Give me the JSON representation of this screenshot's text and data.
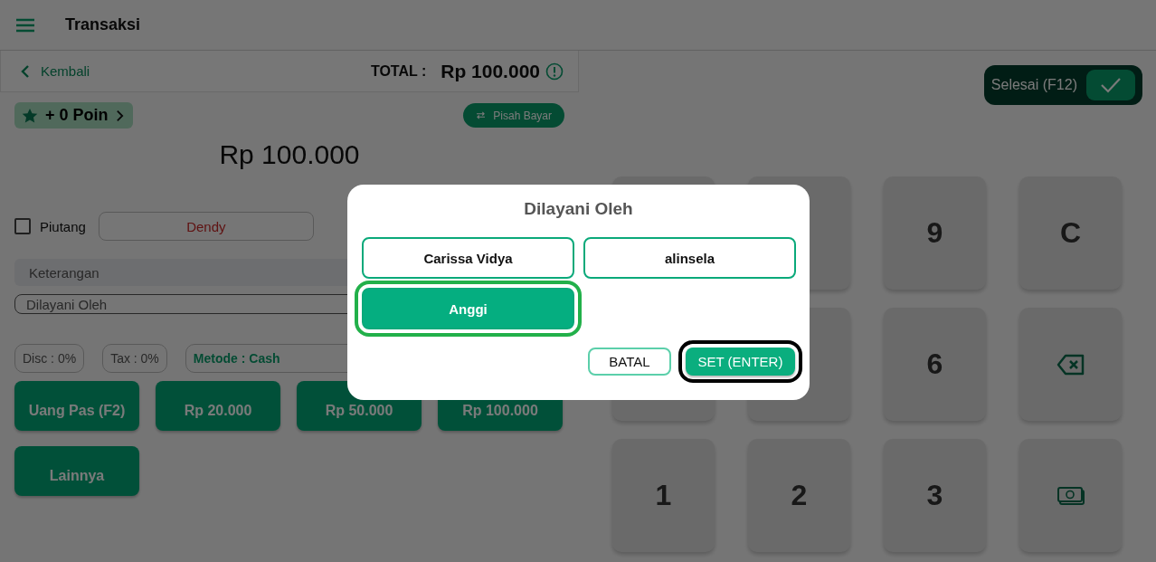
{
  "header": {
    "title": "Transaksi"
  },
  "summary": {
    "back_label": "Kembali",
    "total_label": "TOTAL :",
    "total_value": "Rp 100.000"
  },
  "points": {
    "label": "+ 0 Poin"
  },
  "split_button": {
    "label": "Pisah Bayar"
  },
  "amount": "Rp 100.000",
  "piutang": {
    "label": "Piutang",
    "checked": false
  },
  "customer": "Dendy",
  "notes": {
    "placeholder": "Keterangan"
  },
  "served_by": {
    "placeholder": "Dilayani Oleh"
  },
  "disc": "Disc : 0%",
  "tax": "Tax : 0%",
  "method": "Metode : Cash",
  "quick_buttons": [
    "Uang Pas (F2)",
    "Rp 20.000",
    "Rp 50.000",
    "Rp 100.000",
    "Lainnya"
  ],
  "finish_button": {
    "label": "Selesai (F12)"
  },
  "keypad": [
    {
      "kind": "hidden"
    },
    {
      "kind": "hidden"
    },
    {
      "kind": "key",
      "label": "9"
    },
    {
      "kind": "key",
      "label": "C"
    },
    {
      "kind": "hidden"
    },
    {
      "kind": "hidden"
    },
    {
      "kind": "key",
      "label": "6"
    },
    {
      "kind": "backspace"
    },
    {
      "kind": "key",
      "label": "1"
    },
    {
      "kind": "key",
      "label": "2"
    },
    {
      "kind": "key",
      "label": "3"
    },
    {
      "kind": "cash"
    }
  ],
  "dialog": {
    "title": "Dilayani Oleh",
    "options": [
      {
        "label": "Carissa Vidya",
        "selected": false,
        "highlighted": false
      },
      {
        "label": "alinsela",
        "selected": false,
        "highlighted": false
      },
      {
        "label": "Anggi",
        "selected": true,
        "highlighted": true
      }
    ],
    "cancel_button": "BATAL",
    "confirm_button": {
      "label": "SET (ENTER)",
      "highlighted": true
    }
  }
}
